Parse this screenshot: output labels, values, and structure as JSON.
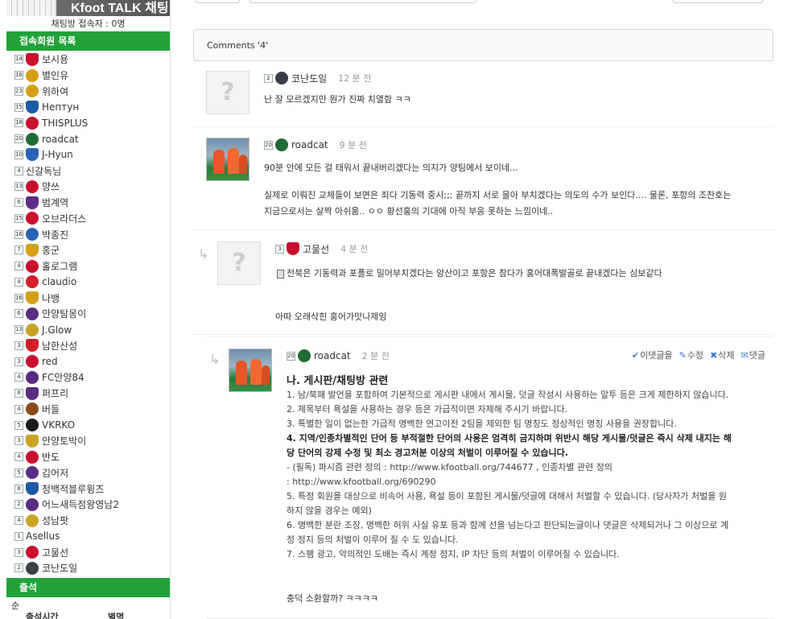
{
  "sidebar": {
    "logo_text": "Kfoot TALK 채팅",
    "chat_count": "채팅방 접속자 : 0명",
    "members_header": "접속회원 목록",
    "members": [
      {
        "lvl": "14",
        "name": "보시용",
        "color": "#c8102e"
      },
      {
        "lvl": "18",
        "name": "별인유",
        "color": "#d4a017"
      },
      {
        "lvl": "23",
        "name": "위하여",
        "color": "#d4a017"
      },
      {
        "lvl": "15",
        "name": "Нептун",
        "color": "#1e5aa8"
      },
      {
        "lvl": "18",
        "name": "THISPLUS",
        "color": "#c8102e"
      },
      {
        "lvl": "20",
        "name": "roadcat",
        "color": "#1f6b34"
      },
      {
        "lvl": "10",
        "name": "J-Hyun",
        "color": "#2a63b5"
      },
      {
        "lvl": "4",
        "name": "신갈독님",
        "color": ""
      },
      {
        "lvl": "13",
        "name": "양쓰",
        "color": "#c8102e"
      },
      {
        "lvl": "6",
        "name": "범계역",
        "color": "#5b2c83"
      },
      {
        "lvl": "15",
        "name": "오브라더스",
        "color": "#c8102e"
      },
      {
        "lvl": "16",
        "name": "박종진",
        "color": "#2a63b5"
      },
      {
        "lvl": "7",
        "name": "홍군",
        "color": "#d4a017"
      },
      {
        "lvl": "4",
        "name": "홀로그램",
        "color": "#c8102e"
      },
      {
        "lvl": "4",
        "name": "claudio",
        "color": "#d11f2a"
      },
      {
        "lvl": "16",
        "name": "나뱅",
        "color": "#d4a017"
      },
      {
        "lvl": "6",
        "name": "안양탐몽이",
        "color": "#5b2c83"
      },
      {
        "lvl": "13",
        "name": "J.Glow",
        "color": "#c9a227"
      },
      {
        "lvl": "3",
        "name": "남한산성",
        "color": "#d11f2a"
      },
      {
        "lvl": "3",
        "name": "red",
        "color": "#c8102e"
      },
      {
        "lvl": "4",
        "name": "FC안양84",
        "color": "#5b2c83"
      },
      {
        "lvl": "8",
        "name": "퍼프리",
        "color": "#5b2c83"
      },
      {
        "lvl": "4",
        "name": "버들",
        "color": "#8a4b1c"
      },
      {
        "lvl": "5",
        "name": "VKRKO",
        "color": "#1a1a1a"
      },
      {
        "lvl": "3",
        "name": "안양토박이",
        "color": "#c9a227"
      },
      {
        "lvl": "4",
        "name": "반도",
        "color": "#c8102e"
      },
      {
        "lvl": "5",
        "name": "김어저",
        "color": "#5b2c83"
      },
      {
        "lvl": "8",
        "name": "청백적블루윙즈",
        "color": "#1e5aa8"
      },
      {
        "lvl": "2",
        "name": "어느새득점왕영남2",
        "color": "#5b2c83"
      },
      {
        "lvl": "4",
        "name": "성남팟",
        "color": "#c9a227"
      },
      {
        "lvl": "1",
        "name": "Asellus",
        "color": ""
      },
      {
        "lvl": "3",
        "name": "고물선",
        "color": "#c8102e"
      },
      {
        "lvl": "2",
        "name": "코난도일",
        "color": "#3a3f47"
      }
    ],
    "attendance_header": "출석",
    "attendance_rank": "순",
    "attendance_col_time": "출석시간",
    "attendance_col_nick": "별명"
  },
  "comments_title": "Comments '4'",
  "comments": [
    {
      "lvl": "2",
      "author": "코난도일",
      "time": "12 분 전",
      "text": [
        "난 잘 모르겠지만 뭔가 진짜 치열함 ㅋㅋ"
      ]
    },
    {
      "lvl": "20",
      "author": "roadcat",
      "time": "9 분 전",
      "text": [
        "90분 안에 모든 걸 태워서 끝내버리겠다는 의지가 양팀에서 보이네...",
        "",
        "실제로 이뤄진 교체들이 보면은 죄다 기동력 중시;;; 끝까지 서로 몰아 부치겠다는 의도의 수가 보인다.... 물론, 포항의 조찬호는",
        "지금으로서는 살짝 아쉬움.. ㅇㅇ 황선홍의 기대에 아직 부응 못하는 느낌이네.."
      ]
    },
    {
      "lvl": "3",
      "author": "고물선",
      "time": "4 분 전",
      "text": [
        "전북은 기동력과 포플로 밀어부치겠다는 양산이고 포항은 참다가 홍어대폭발골로 끝내겠다는 심보같다",
        "아따 오래삭힌 홍어가맛나제잉"
      ]
    },
    {
      "lvl": "20",
      "author": "roadcat",
      "time": "2 분 전",
      "actions": {
        "reply_label": "이댓글을",
        "edit_label": "수정",
        "delete_label": "삭제",
        "comment_label": "댓글"
      },
      "rules_title": "나. 게시판/채팅방 관련",
      "rules": [
        "1. 남/북패 발언을 포함하여 기본적으로 게시판 내에서 게시물, 덧글 작성시 사용하는 말투 등은 크게 제한하지 않습니다.",
        "2. 제목부터 욕설을 사용하는 경우 등은 가급적이면 자제해 주시기 바랍니다.",
        "3. 특별한 일이 없는한 가급적 명백한 연고이전 2팀을 제외한 팀 명칭도 정상적인 명칭 사용을 권장합니다.",
        "4. 지역/인종차별적인 단어 등 부적절한 단어의 사용은 엄격히 금지하며 위반시 해당 게시물/덧글은 즉시 삭제 내지는 해",
        "당 단어의 강제 수정 및 최소 경고처분 이상의 처벌이 이루어질 수 있습니다.",
        "- (필독) 파시즘 관련 정의 : http://www.kfootball.org/744677 , 인종차별 관련 정의",
        ": http://www.kfootball.org/690290",
        "5. 특정 회원을 대상으로 비속어 사용, 욕설 등이 포함된 게시물/덧글에 대해서 처벌할 수 있습니다. (당사자가 처벌을 원",
        "하지 않을 경우는 예외)",
        "6. 명백한 분란 조장, 명백한 허위 사실 유포 등과 함께 선을 넘는다고 판단되는글이나 댓글은 삭제되거나 그 이상으로 계",
        "정 정지 등의 처벌이 이루어 질 수 도 있습니다.",
        "7. 스팸 광고, 악의적인 도배는 즉시 계정 정지, IP 차단 등의 처벌이 이루어질 수 있습니다."
      ],
      "footer": "충덕 소환할까? ㅋㅋㅋㅋ"
    }
  ],
  "avatar_placeholder": "?"
}
